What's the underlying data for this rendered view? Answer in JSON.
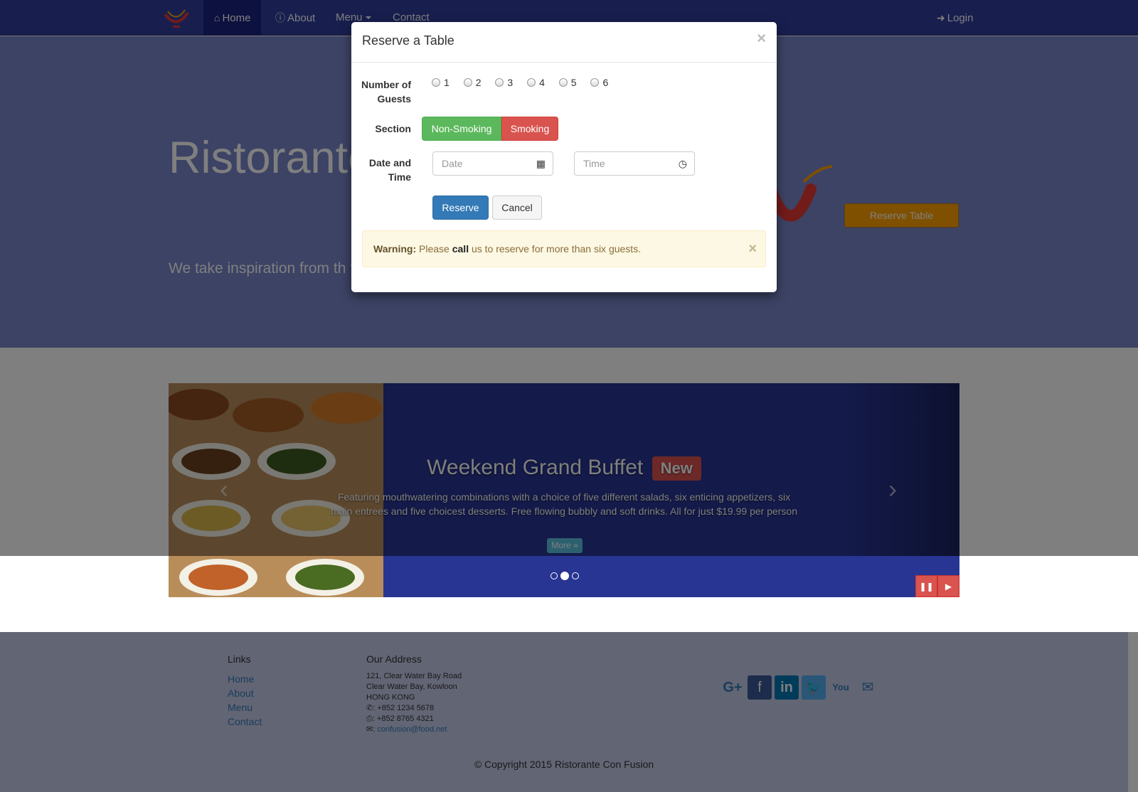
{
  "navbar": {
    "brand_icon": "logo-icon",
    "items": [
      {
        "label": "Home",
        "icon": "home-icon",
        "active": true
      },
      {
        "label": "About",
        "icon": "info-icon"
      },
      {
        "label": "Menu",
        "icon": "caret-down-icon"
      },
      {
        "label": "Contact"
      }
    ],
    "login_label": "Login"
  },
  "jumbotron": {
    "title": "Ristorante",
    "text": "We take inspiration from th fusion experience. Our lips senses!",
    "reserve_button": "Reserve Table"
  },
  "carousel": {
    "caption_title": "Weekend Grand Buffet",
    "badge": "New",
    "caption_text": "Featuring mouthwatering combinations with a choice of five different salads, six enticing appetizers, six main entrees and five choicest desserts. Free flowing bubbly and soft drinks. All for just $19.99 per person",
    "more_button": "More »",
    "indicators": 3,
    "active_indicator": 1
  },
  "modal": {
    "title": "Reserve a Table",
    "close": "×",
    "guests_label": "Number of Guests",
    "guest_options": [
      "1",
      "2",
      "3",
      "4",
      "5",
      "6"
    ],
    "section_label": "Section",
    "section_options": [
      "Non-Smoking",
      "Smoking"
    ],
    "datetime_label": "Date and Time",
    "date_placeholder": "Date",
    "time_placeholder": "Time",
    "reserve_button": "Reserve",
    "cancel_button": "Cancel",
    "alert": {
      "strong": "Warning:",
      "pre": "Please",
      "emph": "call",
      "post": "us to reserve for more than six guests."
    }
  },
  "footer": {
    "links_heading": "Links",
    "links": [
      "Home",
      "About",
      "Menu",
      "Contact"
    ],
    "address_heading": "Our Address",
    "address_lines": [
      "121, Clear Water Bay Road",
      "Clear Water Bay, Kowloon",
      "HONG KONG"
    ],
    "phone": ": +852 1234 5678",
    "fax": ": +852 8765 4321",
    "email": "confusion@food.net",
    "social_icons": [
      "google-plus-icon",
      "facebook-icon",
      "linkedin-icon",
      "twitter-icon",
      "youtube-icon",
      "mail-icon"
    ],
    "copyright": "© Copyright 2015 Ristorante Con Fusion"
  },
  "colors": {
    "primary": "#303F9F",
    "jumbotron": "#7986CB",
    "footer": "#C5CAE9",
    "accent": "#FFA000"
  }
}
